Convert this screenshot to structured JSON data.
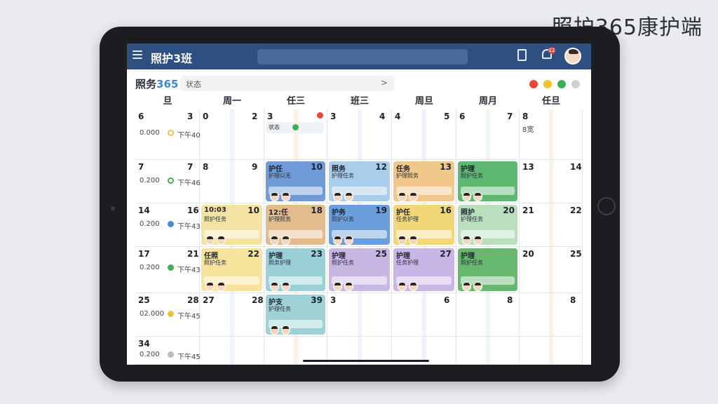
{
  "watermark": "照护365康护端",
  "app": {
    "title": "照护3班",
    "notif_count": "12"
  },
  "sub": {
    "title_a": "照务",
    "title_b": "365",
    "filter_label": "状态",
    "filter_arrow": ">"
  },
  "status_colors": [
    "#e8473b",
    "#f2c02c",
    "#3fae55",
    "#cfd1d6"
  ],
  "days": [
    "旦",
    "周一",
    "任三",
    "班三",
    "周旦",
    "周月",
    "任旦"
  ],
  "rows": [
    {
      "c0": {
        "a": "6",
        "b": "3",
        "t1": "0.000",
        "t2": "下午40",
        "ring": "#e6c65a",
        "hollow": true
      },
      "c1": {
        "a": "0",
        "b": "2"
      },
      "c2": {
        "a": "3",
        "status": "状态"
      },
      "c3": {
        "a": "3",
        "b": "4"
      },
      "c4": {
        "a": "4",
        "b": "5"
      },
      "c5": {
        "a": "6",
        "b": "7"
      },
      "c6": {
        "a": "8",
        "sub": "8宽"
      }
    },
    {
      "c0": {
        "a": "7",
        "b": "7",
        "t1": "0.200",
        "t2": "下午46",
        "ring": "#3fae55",
        "hollow": true
      },
      "c1": {
        "a": "8",
        "b": "9"
      },
      "c2": {
        "title": "护任",
        "n": "10",
        "line": "护理以无"
      },
      "c3": {
        "title": "照务",
        "n": "12",
        "line": "护理任务"
      },
      "c4": {
        "title": "任务",
        "n": "13",
        "line": "护理照务"
      },
      "c5": {
        "title": "护理",
        "line": "照护任务"
      },
      "c6": {
        "a": "13",
        "b": "14"
      }
    },
    {
      "c0": {
        "a": "14",
        "b": "16",
        "t1": "0.200",
        "t2": "下午43",
        "ring": "#4a8ad6",
        "hollow": false
      },
      "c1": {
        "title": "10:03",
        "n": "10",
        "line": "照护任务"
      },
      "c2": {
        "title": "12:任",
        "n": "18",
        "line": "护理照务"
      },
      "c3": {
        "title": "护务",
        "n": "19",
        "line": "照护以务"
      },
      "c4": {
        "title": "护任",
        "n": "16",
        "line": "任务护理"
      },
      "c5": {
        "title": "照护",
        "n": "20",
        "line": "护理任务"
      },
      "c6": {
        "a": "21",
        "b": "22"
      }
    },
    {
      "c0": {
        "a": "17",
        "b": "21",
        "t1": "0.200",
        "t2": "下午43",
        "ring": "#3fae55",
        "hollow": false
      },
      "c1": {
        "title": "任照",
        "n": "22",
        "line": "照护任务"
      },
      "c2": {
        "title": "护理",
        "n": "23",
        "line": "照务护理"
      },
      "c3": {
        "title": "护理",
        "n": "25",
        "line": "照护任务"
      },
      "c4": {
        "title": "护理",
        "n": "27",
        "line": "任务护理"
      },
      "c5": {
        "title": "护理",
        "line": "照护任务"
      },
      "c6": {
        "a": "20",
        "b": "25"
      }
    },
    {
      "c0": {
        "a": "25",
        "b": "28",
        "t1": "02.000",
        "t2": "下午45",
        "ring": "#e6c53a",
        "hollow": false
      },
      "c1": {
        "a": "27",
        "b": "28"
      },
      "c2": {
        "title": "护支",
        "n": "39",
        "line": "护理任务"
      },
      "c3": {
        "a": "3"
      },
      "c4": {
        "b": "6"
      },
      "c5": {
        "b": "8"
      },
      "c6": {
        "b": "8"
      }
    },
    {
      "c0": {
        "a": "34",
        "t1": "0.200",
        "t2": "下午45",
        "ring": "#b8bbc1",
        "hollow": false
      }
    }
  ]
}
